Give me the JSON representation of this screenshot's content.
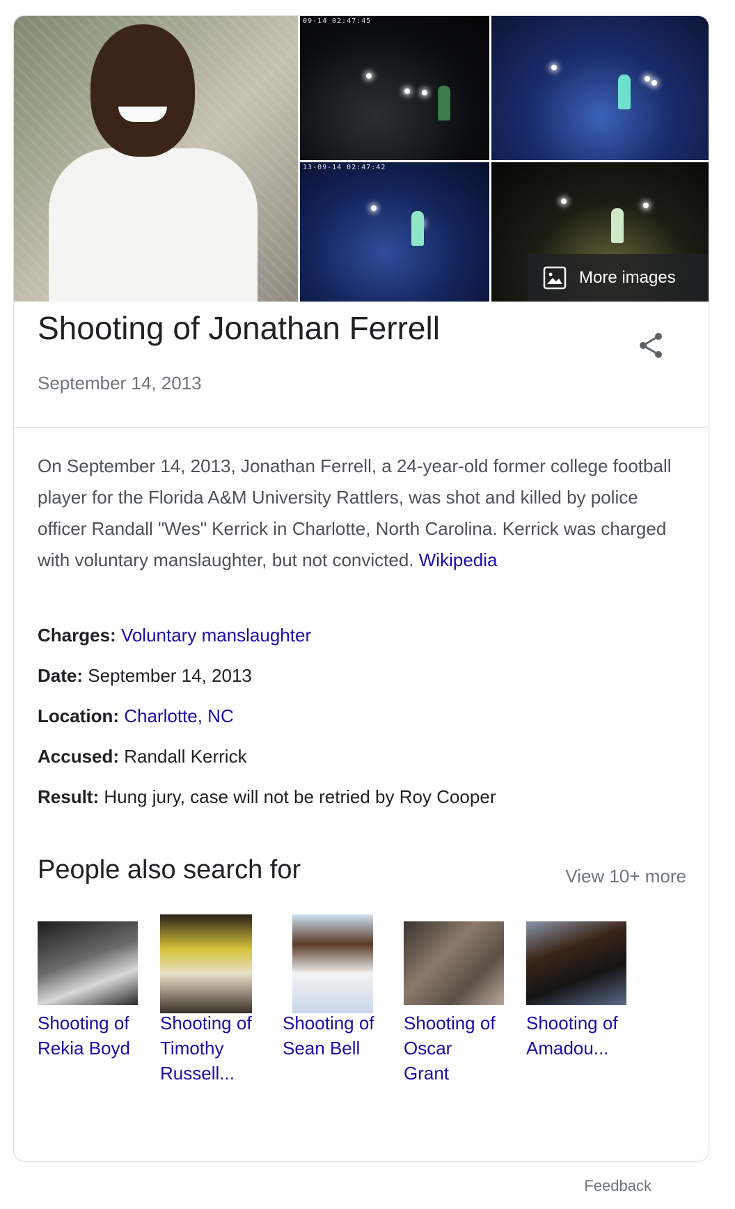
{
  "images": {
    "more_images_label": "More images",
    "timestamp_1": "09-14 02:47:45",
    "timestamp_2": "13-09-14 02:47:42"
  },
  "header": {
    "title": "Shooting of Jonathan Ferrell",
    "subtitle": "September 14, 2013",
    "share_icon": "share-icon"
  },
  "description": {
    "text": "On September 14, 2013, Jonathan Ferrell, a 24-year-old former college football player for the Florida A&M University Rattlers, was shot and killed by police officer Randall \"Wes\" Kerrick in Charlotte, North Carolina. Kerrick was charged with voluntary manslaughter, but not convicted.",
    "source_link": "Wikipedia"
  },
  "facts": [
    {
      "label": "Charges:",
      "value": "Voluntary manslaughter",
      "is_link": true
    },
    {
      "label": "Date:",
      "value": "September 14, 2013",
      "is_link": false
    },
    {
      "label": "Location:",
      "value": "Charlotte, NC",
      "is_link": true
    },
    {
      "label": "Accused:",
      "value": "Randall Kerrick",
      "is_link": false
    },
    {
      "label": "Result:",
      "value": "Hung jury, case will not be retried by Roy Cooper",
      "is_link": false
    }
  ],
  "people_also_search": {
    "header": "People also search for",
    "view_more": "View 10+ more",
    "items": [
      {
        "label_line1": "Shooting of",
        "label_line2": "Rekia Boyd",
        "label_line3": ""
      },
      {
        "label_line1": "Shooting of",
        "label_line2": "Timothy",
        "label_line3": "Russell..."
      },
      {
        "label_line1": "Shooting of",
        "label_line2": "Sean Bell",
        "label_line3": ""
      },
      {
        "label_line1": "Shooting of",
        "label_line2": "Oscar",
        "label_line3": "Grant"
      },
      {
        "label_line1": "Shooting of",
        "label_line2": "Amadou...",
        "label_line3": ""
      }
    ]
  },
  "footer": {
    "feedback": "Feedback"
  },
  "colors": {
    "link": "#1a0dab",
    "text": "#202124",
    "secondary": "#70757a",
    "border": "#dadce0"
  }
}
